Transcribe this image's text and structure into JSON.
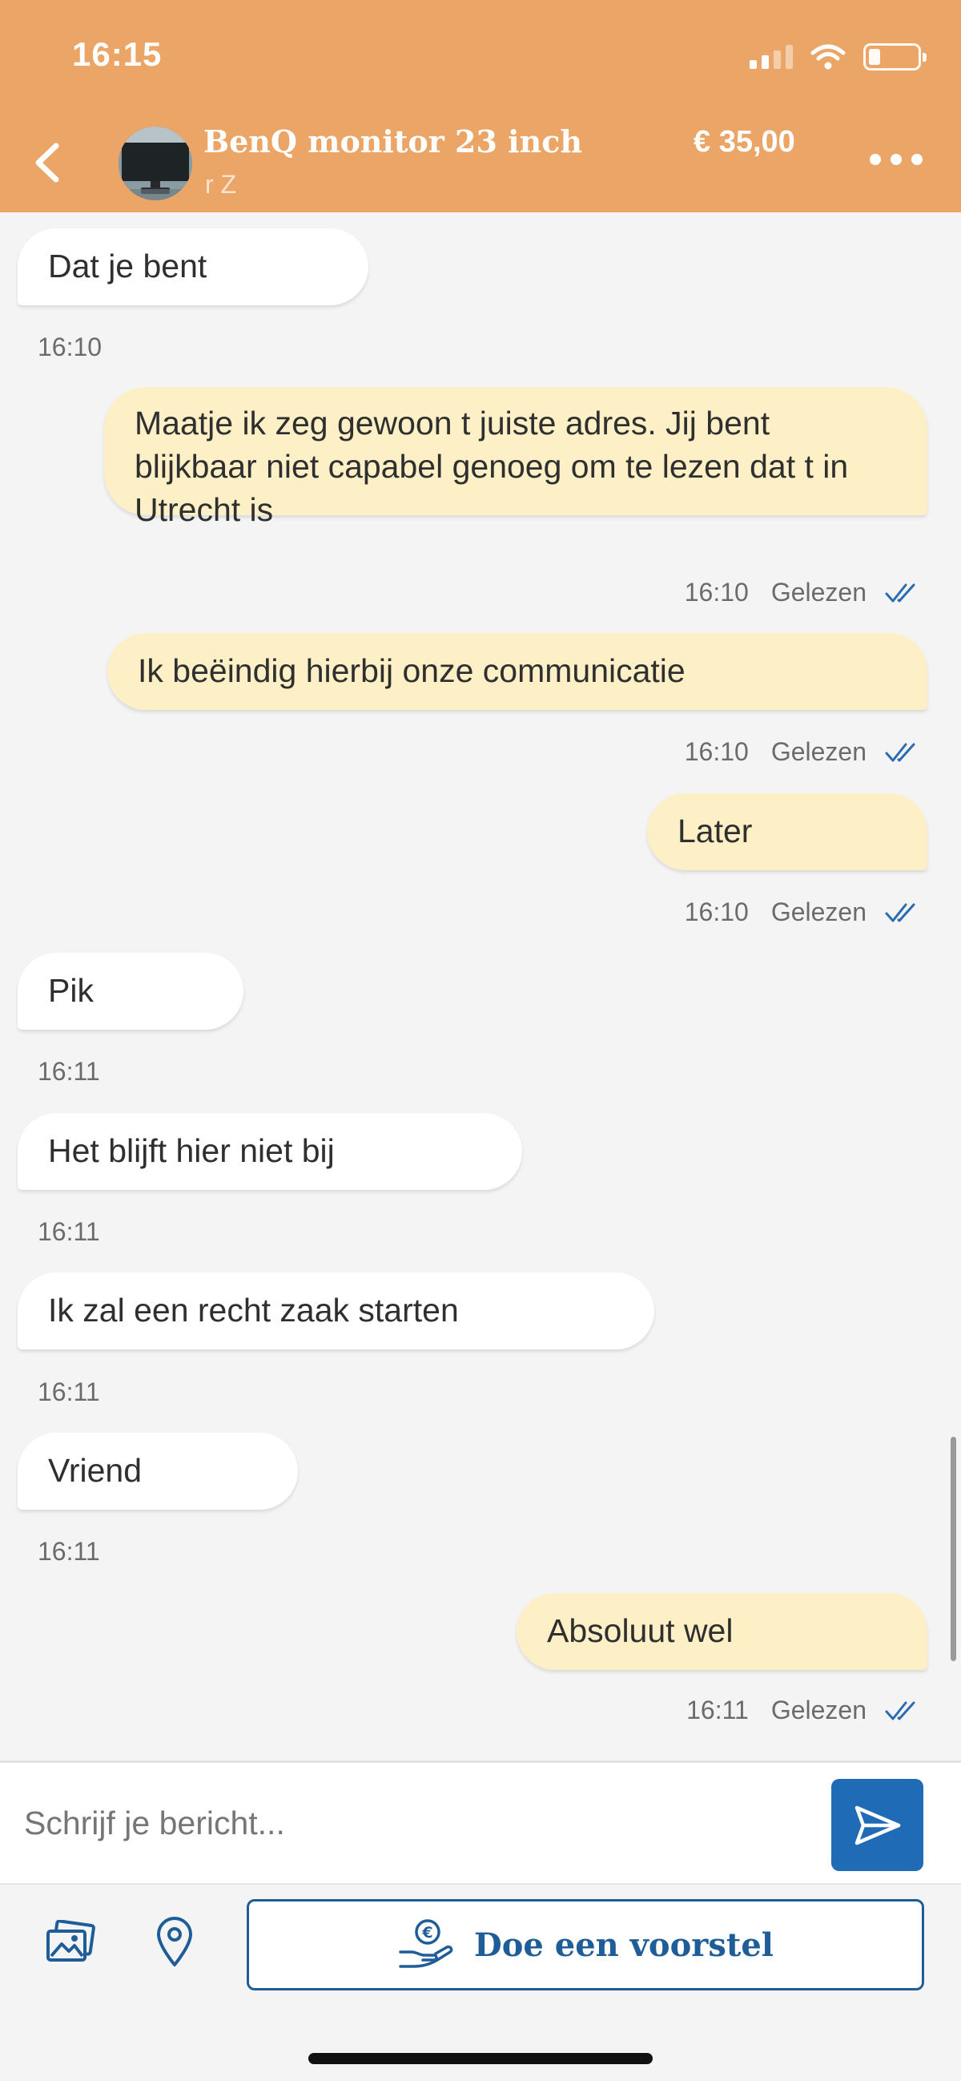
{
  "status_bar": {
    "time": "16:15"
  },
  "header": {
    "listing_title": "BenQ monitor 23 inch",
    "seller_name": "r Z",
    "price": "€ 35,00"
  },
  "messages": [
    {
      "direction": "incoming",
      "text": "Dat je bent",
      "time": "16:10"
    },
    {
      "direction": "outgoing",
      "text": "Maatje ik zeg gewoon t juiste adres. Jij bent blijkbaar niet capabel genoeg om te lezen dat t in Utrecht is",
      "time": "16:10",
      "status": "Gelezen"
    },
    {
      "direction": "outgoing",
      "text": "Ik beëindig hierbij onze communicatie",
      "time": "16:10",
      "status": "Gelezen"
    },
    {
      "direction": "outgoing",
      "text": "Later",
      "time": "16:10",
      "status": "Gelezen"
    },
    {
      "direction": "incoming",
      "text": "Pik",
      "time": "16:11"
    },
    {
      "direction": "incoming",
      "text": "Het blijft hier niet bij",
      "time": "16:11"
    },
    {
      "direction": "incoming",
      "text": "Ik zal een recht zaak starten",
      "time": "16:11"
    },
    {
      "direction": "incoming",
      "text": "Vriend",
      "time": "16:11"
    },
    {
      "direction": "outgoing",
      "text": "Absoluut wel",
      "time": "16:11",
      "status": "Gelezen"
    }
  ],
  "composer": {
    "placeholder": "Schrijf je bericht...",
    "value": ""
  },
  "actions": {
    "offer_label": "Doe een voorstel"
  },
  "colors": {
    "header_bg": "#eba566",
    "outgoing_bubble": "#fdefc6",
    "incoming_bubble": "#ffffff",
    "accent_blue": "#1f6bb5",
    "read_check": "#2a6cb0"
  },
  "icons": {
    "back": "chevron-left-icon",
    "more": "more-dots-icon",
    "send": "send-icon",
    "photo": "image-icon",
    "location": "map-pin-icon",
    "offer": "euro-hand-icon",
    "read": "double-check-icon"
  }
}
